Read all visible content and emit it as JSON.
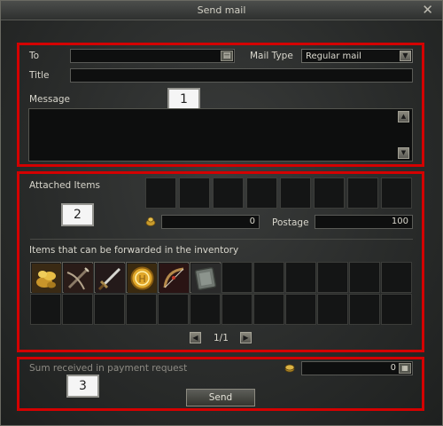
{
  "window": {
    "title": "Send mail",
    "close_symbol": "✕"
  },
  "annotations": {
    "box1": "1",
    "box2": "2",
    "box3": "3"
  },
  "compose": {
    "to_label": "To",
    "to_value": "",
    "mail_type_label": "Mail Type",
    "mail_type_value": "Regular mail",
    "title_label": "Title",
    "title_value": "",
    "message_label": "Message",
    "message_value": ""
  },
  "attachments": {
    "label": "Attached Items",
    "adena_value": "0",
    "postage_label": "Postage",
    "postage_value": "100",
    "attached_slots": 8
  },
  "inventory": {
    "label": "Items that can be forwarded in the inventory",
    "items": [
      {
        "icon": "gold-coins-pouch-icon"
      },
      {
        "icon": "crossbow-icon"
      },
      {
        "icon": "sword-icon"
      },
      {
        "icon": "gold-coin-icon"
      },
      {
        "icon": "bow-icon"
      },
      {
        "icon": "spellbook-icon"
      }
    ],
    "page": "1/1"
  },
  "payment": {
    "label": "Sum received in payment request",
    "value": "0",
    "send_label": "Send"
  },
  "colors": {
    "highlight": "#d40000",
    "panel_bg": "#2e302f",
    "slot_bg": "#141515"
  }
}
